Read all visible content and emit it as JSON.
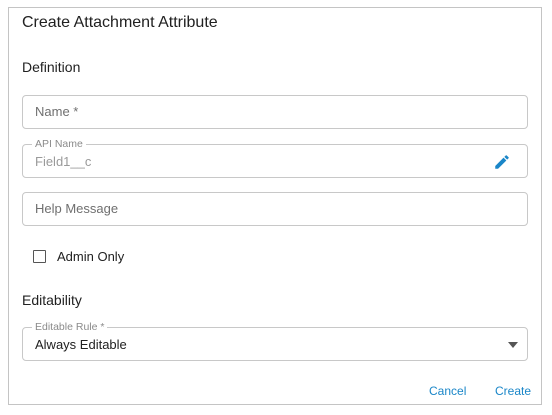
{
  "dialog": {
    "title": "Create Attachment Attribute"
  },
  "definition": {
    "heading": "Definition",
    "name_placeholder": "Name *",
    "api_name_legend": "API Name",
    "api_name_value": "Field1__c",
    "help_placeholder": "Help Message",
    "admin_only_label": "Admin Only",
    "admin_only_checked": false
  },
  "editability": {
    "heading": "Editability",
    "rule_legend": "Editable Rule *",
    "rule_value": "Always Editable"
  },
  "actions": {
    "cancel_label": "Cancel",
    "create_label": "Create"
  },
  "colors": {
    "accent": "#1a86c8",
    "border": "#c8c8c8"
  },
  "icons": {
    "edit": "pencil-icon",
    "dropdown": "caret-down-icon"
  }
}
